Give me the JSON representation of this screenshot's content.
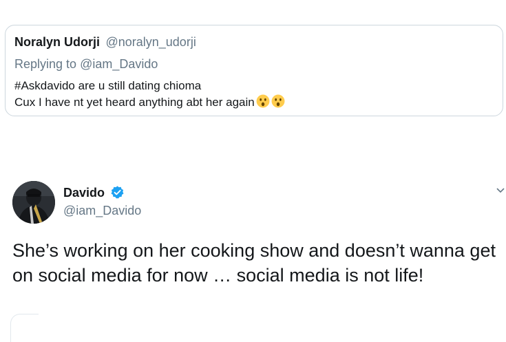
{
  "quoted_tweet": {
    "author_name": "Noralyn Udorji",
    "author_handle": "@noralyn_udorji",
    "replying_prefix": "Replying to",
    "replying_handle": "@iam_Davido",
    "line1": "#Askdavido are u still dating chioma",
    "line2": "Cux I have nt yet heard anything abt her again",
    "emojis": [
      "astonished-face-emoji",
      "astonished-face-emoji"
    ]
  },
  "tweet": {
    "author_name": "Davido",
    "author_handle": "@iam_Davido",
    "verified": true,
    "text": "She’s working on her cooking show and doesn’t wanna get on social media for now … social media is not life!"
  },
  "colors": {
    "text_primary": "#14171a",
    "text_secondary": "#657786",
    "border": "#ccd6dd",
    "verified_blue": "#1da1f2",
    "emoji_yellow": "#ffcc4d"
  }
}
